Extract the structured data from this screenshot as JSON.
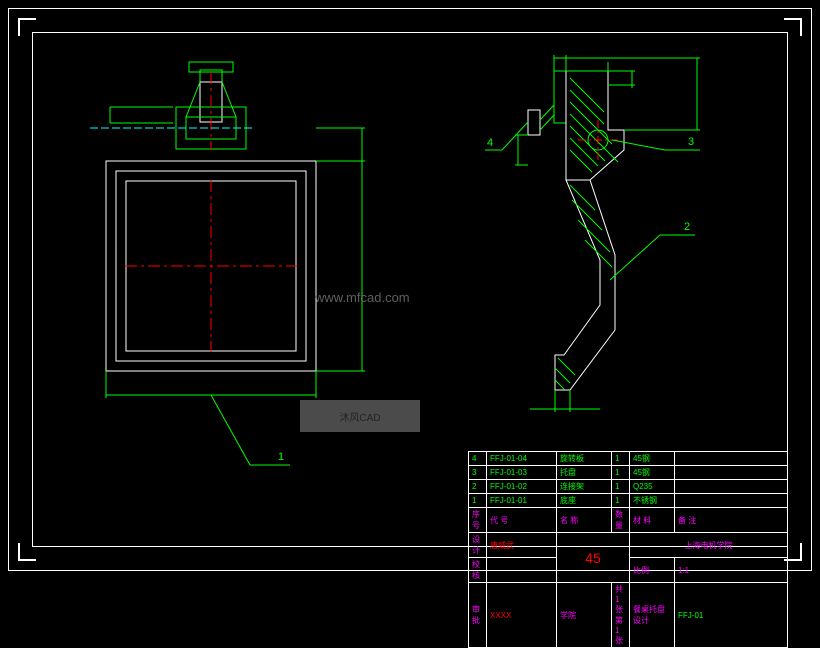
{
  "watermark": "www.mfcad.com",
  "watermark2": "沐风CAD",
  "leaders": {
    "l1": "1",
    "l2": "2",
    "l3": "3",
    "l4": "4"
  },
  "titleblock": {
    "bom": [
      {
        "no": "4",
        "code": "FFJ-01-04",
        "name": "旋转板",
        "qty": "1",
        "mat": "45钢",
        "note": ""
      },
      {
        "no": "3",
        "code": "FFJ-01-03",
        "name": "托盘",
        "qty": "1",
        "mat": "45钢",
        "note": ""
      },
      {
        "no": "2",
        "code": "FFJ-01-02",
        "name": "连接架",
        "qty": "1",
        "mat": "Q235",
        "note": ""
      },
      {
        "no": "1",
        "code": "FFJ-01-01",
        "name": "底座",
        "qty": "1",
        "mat": "不锈钢",
        "note": ""
      }
    ],
    "hdr_no": "序号",
    "hdr_code": "代 号",
    "hdr_name": "名 称",
    "hdr_qty": "数量",
    "hdr_mat": "材 料",
    "hdr_note": "备 注",
    "design": "设计",
    "designer": "唐威武",
    "check": "校核",
    "examine": "审批",
    "class": "XXXX",
    "school_lbl": "学院",
    "scale_lbl": "比例",
    "scale": "1:1",
    "sheet": "共1张  第1张",
    "material": "45",
    "org": "上海电机学院",
    "project": "餐桌托盘设计",
    "drawing_no": "FFJ-01"
  }
}
